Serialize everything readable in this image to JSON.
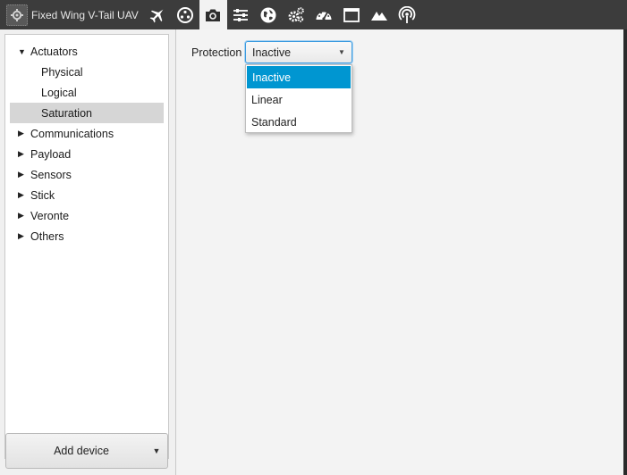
{
  "app": {
    "title": "Fixed Wing V-Tail UAV",
    "app_icon": "gear-chip-icon"
  },
  "toolbar": {
    "icons": [
      "airplane-icon",
      "joystick-icon",
      "camera-icon",
      "sliders-icon",
      "globe-icon",
      "gears-icon",
      "gauge-icon",
      "window-icon",
      "terrain-icon",
      "antenna-icon"
    ],
    "active": "camera-icon"
  },
  "tree": {
    "items": [
      {
        "label": "Actuators",
        "level": 0,
        "expanded": true
      },
      {
        "label": "Physical",
        "level": 1
      },
      {
        "label": "Logical",
        "level": 1
      },
      {
        "label": "Saturation",
        "level": 1,
        "selected": true
      },
      {
        "label": "Communications",
        "level": 0,
        "expanded": false
      },
      {
        "label": "Payload",
        "level": 0,
        "expanded": false
      },
      {
        "label": "Sensors",
        "level": 0,
        "expanded": false
      },
      {
        "label": "Stick",
        "level": 0,
        "expanded": false
      },
      {
        "label": "Veronte",
        "level": 0,
        "expanded": false
      },
      {
        "label": "Others",
        "level": 0,
        "expanded": false
      }
    ]
  },
  "add_device": {
    "label": "Add device"
  },
  "protection": {
    "label": "Protection",
    "value": "Inactive",
    "options": [
      "Inactive",
      "Linear",
      "Standard"
    ],
    "highlighted": "Inactive"
  },
  "colors": {
    "topbar": "#3c3c3c",
    "selection": "#0096d1",
    "focus_border": "#3b9be0"
  }
}
